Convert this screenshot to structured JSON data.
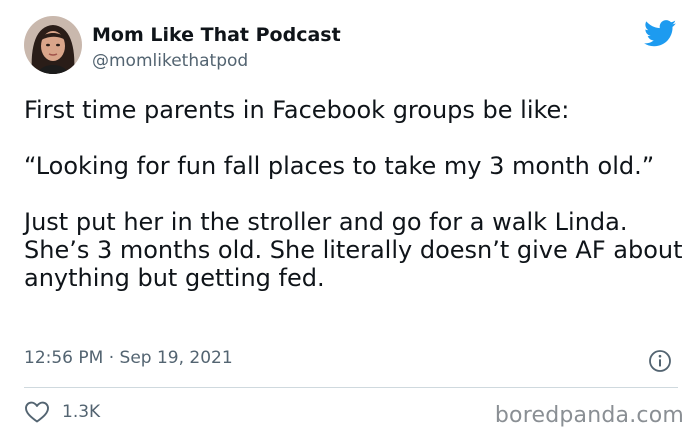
{
  "author": {
    "display_name": "Mom Like That Podcast",
    "handle": "@momlikethatpod"
  },
  "tweet": {
    "paragraphs": [
      "First time parents in Facebook groups be like:",
      "“Looking for fun fall places to take my 3 month old.”",
      "Just put her in the stroller and go for a walk Linda. She’s 3 months old. She literally doesn’t give AF about anything but getting fed."
    ],
    "timestamp": "12:56 PM · Sep 19, 2021",
    "like_count": "1.3K"
  },
  "watermark": "boredpanda.com",
  "colors": {
    "twitter_blue": "#1d9bf0",
    "text": "#0f1419",
    "muted": "#536471",
    "divider": "#cfd9de"
  },
  "icons": {
    "brand": "twitter-bird-icon",
    "info": "info-icon",
    "like": "heart-icon"
  }
}
